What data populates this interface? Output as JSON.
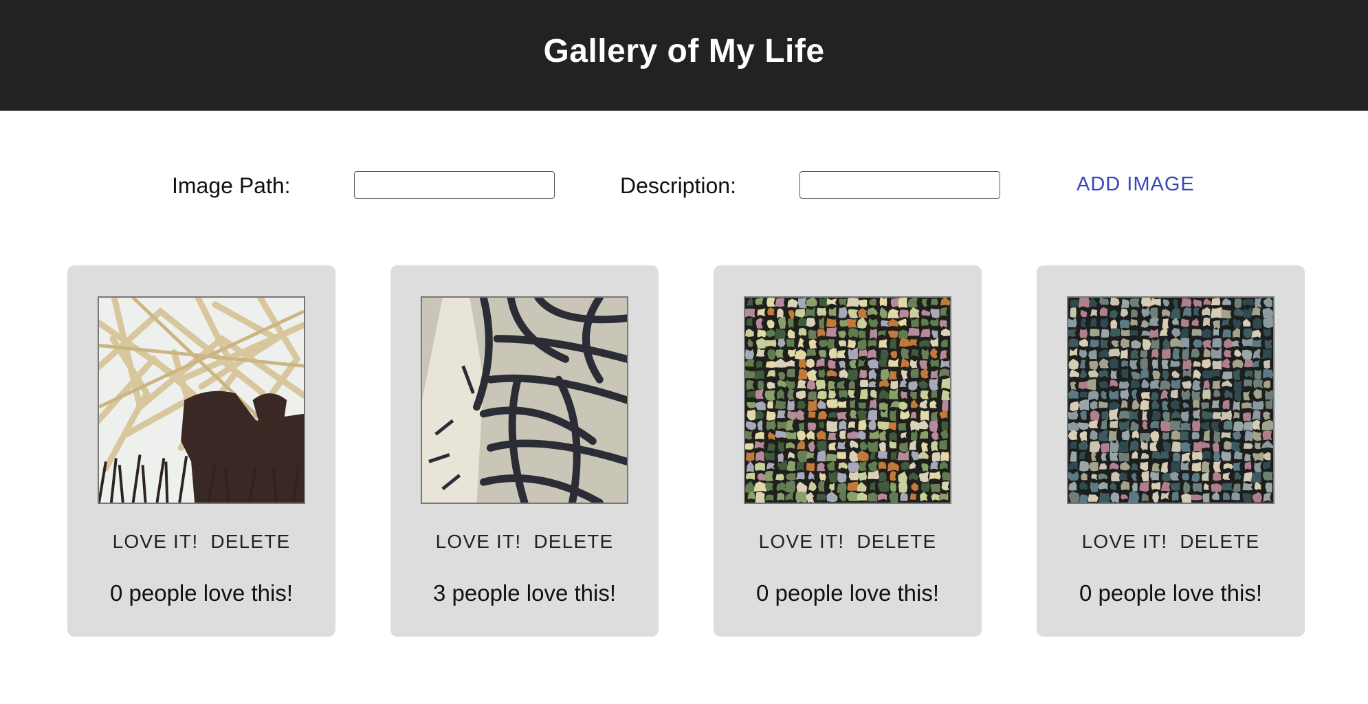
{
  "header": {
    "title": "Gallery of My Life"
  },
  "form": {
    "image_path_label": "Image Path:",
    "image_path_value": "",
    "description_label": "Description:",
    "description_value": "",
    "add_button_label": "ADD IMAGE"
  },
  "cards": [
    {
      "love_label": "LOVE IT!",
      "delete_label": "DELETE",
      "count_text": "0 people love this!"
    },
    {
      "love_label": "LOVE IT!",
      "delete_label": "DELETE",
      "count_text": "3 people love this!"
    },
    {
      "love_label": "LOVE IT!",
      "delete_label": "DELETE",
      "count_text": "0 people love this!"
    },
    {
      "love_label": "LOVE IT!",
      "delete_label": "DELETE",
      "count_text": "0 people love this!"
    }
  ],
  "colors": {
    "header_bg": "#222222",
    "card_bg": "#dddddd",
    "accent": "#3846b5"
  }
}
